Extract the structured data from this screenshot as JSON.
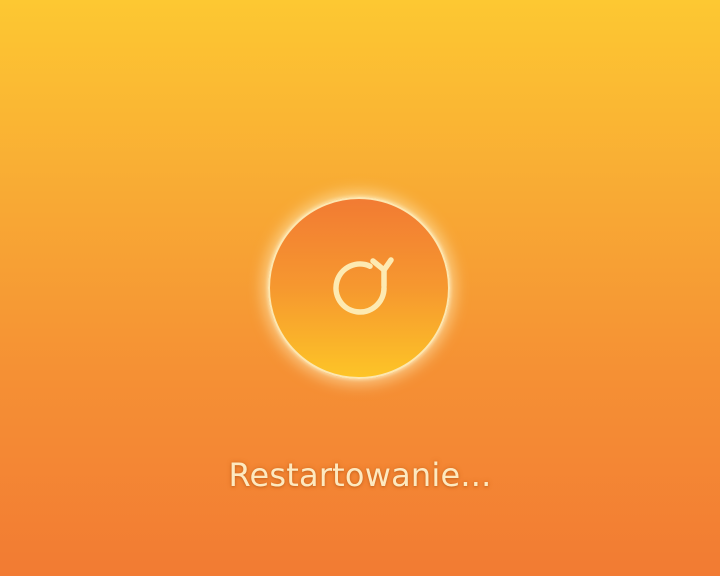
{
  "status": {
    "message": "Restartowanie..."
  },
  "icon": {
    "name": "restart-icon"
  },
  "colors": {
    "background_top": "#fdc832",
    "background_bottom": "#f27b33",
    "circle_border": "#fde7b0",
    "icon_stroke": "#fdeab2",
    "text": "#fde9c0"
  }
}
